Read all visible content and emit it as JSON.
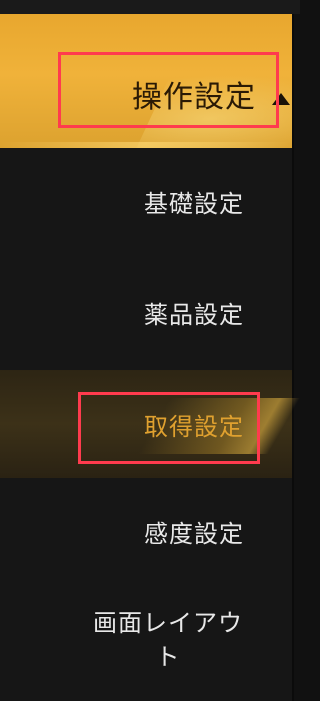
{
  "header": {
    "label": "操作設定",
    "icon": "caret-up-icon",
    "color": "#f0b23a"
  },
  "menu": {
    "items": [
      {
        "label": "基礎設定",
        "active": false
      },
      {
        "label": "薬品設定",
        "active": false
      },
      {
        "label": "取得設定",
        "active": true
      },
      {
        "label": "感度設定",
        "active": false
      },
      {
        "label_line1": "画面レイアウ",
        "label_line2": "ト",
        "active": false
      }
    ]
  },
  "colors": {
    "accent": "#e0a12f",
    "highlight_box": "#ff3b4e",
    "menu_bg": "#161616",
    "text": "#e8e8e8"
  }
}
